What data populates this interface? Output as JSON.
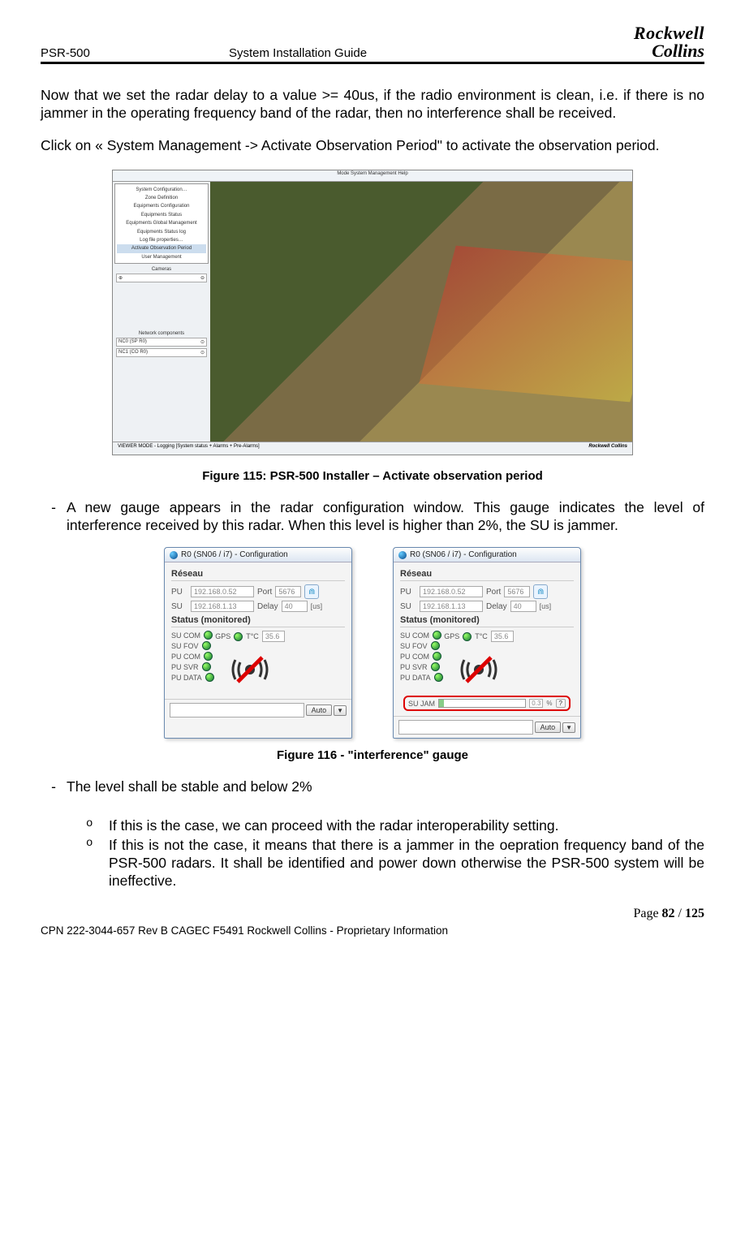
{
  "header": {
    "left": "PSR-500",
    "center": "System Installation Guide",
    "logo_top": "Rockwell",
    "logo_bottom": "Collins"
  },
  "paragraphs": {
    "p1": "Now that we set the radar delay to a value >= 40us, if the radio environment is clean, i.e. if there is no jammer in the operating frequency band of the radar, then no interference shall be received.",
    "p2": "Click on « System Management -> Activate Observation Period\" to activate the observation period."
  },
  "figure1": {
    "caption": "Figure 115: PSR-500 Installer – Activate observation period",
    "menubar": "Mode   System Management   Help",
    "menu_items": [
      "System Configuration…",
      "Zone Definition",
      "Equipments Configuration",
      "Equipments Status",
      "Equipments Global Management",
      "Equipments Status log",
      "Log file properties…",
      "Activate Observation Period",
      "User Management"
    ],
    "menu_highlight_index": 7,
    "cameras_label": "Cameras",
    "network_label": "Network components",
    "network_items": [
      "NC0 (SP R0)",
      "NC1 (CO R0)"
    ],
    "bottombar_left": "VIEWER MODE - Logging [System status + Alarms + Pre-Alarms]",
    "bottombar_right": "Rockwell Collins"
  },
  "bullet1": "A new gauge appears in the radar configuration window. This gauge indicates the level of interference received by this radar. When this level is higher than 2%, the SU is jammer.",
  "config": {
    "title": "R0 (SN06 / i7) - Configuration",
    "section_network": "Réseau",
    "pu_label": "PU",
    "pu_ip": "192.168.0.52",
    "port_label": "Port",
    "port_val": "5676",
    "su_label": "SU",
    "su_ip": "192.168.1.13",
    "delay_label": "Delay",
    "delay_val": "40",
    "delay_unit": "[us]",
    "section_status": "Status (monitored)",
    "status_labels": [
      "SU COM",
      "SU FOV",
      "PU COM",
      "PU SVR",
      "PU DATA"
    ],
    "gps_label": "GPS",
    "temp_label": "T°C",
    "temp_val": "35.6",
    "jam_label": "SU JAM",
    "jam_val": "0.3",
    "jam_unit": "%",
    "jam_help": "?",
    "auto_btn": "Auto",
    "dropdown": "▼"
  },
  "figure2_caption": "Figure 116 - \"interference\" gauge",
  "bullet2": "The level shall be stable and below 2%",
  "sub1": "If this is the case, we can proceed with the radar interoperability setting.",
  "sub2": "If this is not the case, it means that there is a jammer in the oepration frequency band of the PSR-500 radars. It shall be identified and power down otherwise the PSR-500 system will be ineffective.",
  "footer": {
    "page_label": "Page ",
    "page_num": "82",
    "page_sep": " / ",
    "page_total": "125",
    "line": "CPN 222-3044-657 Rev B CAGEC F5491 Rockwell Collins - Proprietary Information"
  }
}
